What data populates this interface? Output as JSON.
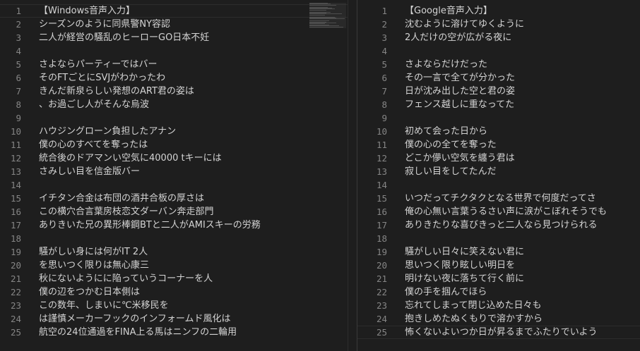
{
  "left_pane": {
    "lines": [
      {
        "number": "1",
        "text": "【Windows音声入力】"
      },
      {
        "number": "2",
        "text": "シーズンのように同県警NY容認"
      },
      {
        "number": "3",
        "text": "二人が経営の騒乱のヒーローGO日本不妊"
      },
      {
        "number": "4",
        "text": ""
      },
      {
        "number": "5",
        "text": "さよならパーティーではバー"
      },
      {
        "number": "6",
        "text": "そのFTごとにSVJがわかったわ"
      },
      {
        "number": "7",
        "text": "きんだ新泉らしい発想のART君の姿は"
      },
      {
        "number": "8",
        "text": "、お過ごし人がそんな烏波"
      },
      {
        "number": "9",
        "text": ""
      },
      {
        "number": "10",
        "text": "ハウジングローン負担したアナン"
      },
      {
        "number": "11",
        "text": "僕の心のすべてを奪ったは"
      },
      {
        "number": "12",
        "text": "統合後のドアマンい空気に40000 tキーには"
      },
      {
        "number": "13",
        "text": "さみしい目を信金版バー"
      },
      {
        "number": "14",
        "text": ""
      },
      {
        "number": "15",
        "text": "イチタン合金は布団の酒井合板の厚さは"
      },
      {
        "number": "16",
        "text": "この横穴合言葉房枝恋文ダーバン奔走部門"
      },
      {
        "number": "17",
        "text": "ありきいた兄の異形棒鋼BTと二人がAMIスキーの労務"
      },
      {
        "number": "18",
        "text": ""
      },
      {
        "number": "19",
        "text": "騒がしい身には何がIT 2人"
      },
      {
        "number": "20",
        "text": "を思いつく限りは無心康三"
      },
      {
        "number": "21",
        "text": "秋にないようにに陥っていうコーナーを人"
      },
      {
        "number": "22",
        "text": "僕の辺をつかむ日本側は"
      },
      {
        "number": "23",
        "text": "この数年、しまいに℃米移民を"
      },
      {
        "number": "24",
        "text": "は謹慎メーカーフックのインフォームド風化は"
      },
      {
        "number": "25",
        "text": "航空の24位通過をFINA上る馬はニンフの二輪用"
      }
    ]
  },
  "right_pane": {
    "lines": [
      {
        "number": "1",
        "text": "【Google音声入力】"
      },
      {
        "number": "2",
        "text": "沈むように溶けてゆくように"
      },
      {
        "number": "3",
        "text": "2人だけの空が広がる夜に"
      },
      {
        "number": "4",
        "text": ""
      },
      {
        "number": "5",
        "text": "さよならだけだった"
      },
      {
        "number": "6",
        "text": "その一言で全てが分かった"
      },
      {
        "number": "7",
        "text": "日が沈み出した空と君の姿"
      },
      {
        "number": "8",
        "text": "フェンス越しに重なってた"
      },
      {
        "number": "9",
        "text": ""
      },
      {
        "number": "10",
        "text": "初めて会った日から"
      },
      {
        "number": "11",
        "text": "僕の心の全てを奪った"
      },
      {
        "number": "12",
        "text": "どこか儚い空気を纏う君は"
      },
      {
        "number": "13",
        "text": "寂しい目をしてたんだ"
      },
      {
        "number": "14",
        "text": ""
      },
      {
        "number": "15",
        "text": "いつだってチクタクとなる世界で何度だってさ"
      },
      {
        "number": "16",
        "text": "俺の心無い言葉うるさい声に涙がこぼれそうでも"
      },
      {
        "number": "17",
        "text": "ありきたりな喜びきっと二人なら見つけられる"
      },
      {
        "number": "18",
        "text": ""
      },
      {
        "number": "19",
        "text": "騒がしい日々に笑えない君に"
      },
      {
        "number": "20",
        "text": "思いつく限り眩しい明日を"
      },
      {
        "number": "21",
        "text": "明けない夜に落ちて行く前に"
      },
      {
        "number": "22",
        "text": "僕の手を掴んでほら"
      },
      {
        "number": "23",
        "text": "忘れてしまって閉じ込めた日々も"
      },
      {
        "number": "24",
        "text": "抱きしめたぬくもりで溶かすから"
      },
      {
        "number": "25",
        "text": "怖くないよいつか日が昇るまでふたりでいよう"
      }
    ]
  },
  "theme": {
    "background": "#1e1e1e",
    "text": "#d4d4d4",
    "line_number": "#858585"
  }
}
